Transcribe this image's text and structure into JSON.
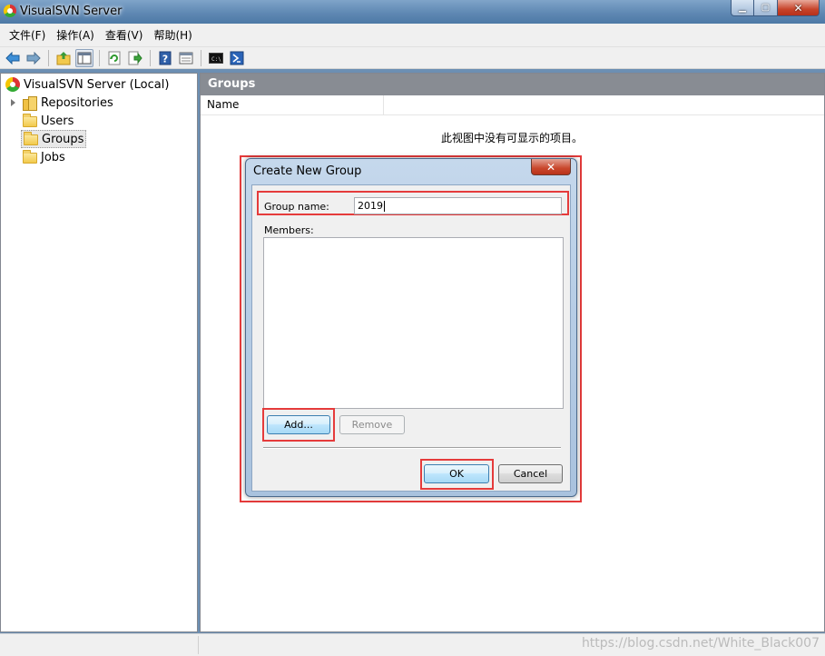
{
  "window": {
    "title": "VisualSVN Server"
  },
  "menu": [
    "文件(F)",
    "操作(A)",
    "查看(V)",
    "帮助(H)"
  ],
  "toolbar": {
    "buttons": [
      "back-icon",
      "forward-icon",
      "up-folder-icon",
      "show-hide-tree-icon",
      "refresh-icon",
      "export-icon",
      "help-icon",
      "properties-icon",
      "console-icon",
      "powershell-icon"
    ]
  },
  "tree": {
    "root": "VisualSVN Server (Local)",
    "items": [
      "Repositories",
      "Users",
      "Groups",
      "Jobs"
    ],
    "selected": "Groups"
  },
  "main": {
    "header": "Groups",
    "columns": [
      "Name"
    ],
    "empty_message": "此视图中没有可显示的项目。"
  },
  "dialog": {
    "title": "Create New Group",
    "close_label": "✕",
    "group_name_label": "Group name:",
    "group_name_value": "2019",
    "members_label": "Members:",
    "add_label": "Add...",
    "remove_label": "Remove",
    "ok_label": "OK",
    "cancel_label": "Cancel"
  },
  "watermark": "https://blog.csdn.net/White_Black007",
  "colors": {
    "highlight": "#e53b3b",
    "pane_header": "#888c93"
  }
}
